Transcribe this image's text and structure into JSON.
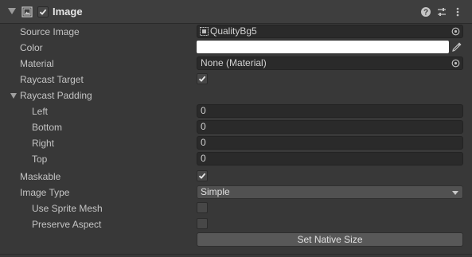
{
  "component": {
    "title": "Image",
    "enabled": true,
    "icon": "image-component-icon",
    "header_icons": [
      "help-icon",
      "preset-icon",
      "menu-kebab-icon"
    ]
  },
  "fields": {
    "source_image": {
      "label": "Source Image",
      "value": "QualityBg5",
      "icon": "sprite-icon"
    },
    "color": {
      "label": "Color",
      "value": "#ffffff"
    },
    "material": {
      "label": "Material",
      "value": "None (Material)"
    },
    "raycast_target": {
      "label": "Raycast Target",
      "checked": true
    },
    "raycast_padding": {
      "label": "Raycast Padding",
      "expanded": true,
      "left": {
        "label": "Left",
        "value": "0"
      },
      "bottom": {
        "label": "Bottom",
        "value": "0"
      },
      "right": {
        "label": "Right",
        "value": "0"
      },
      "top": {
        "label": "Top",
        "value": "0"
      }
    },
    "maskable": {
      "label": "Maskable",
      "checked": true
    },
    "image_type": {
      "label": "Image Type",
      "value": "Simple"
    },
    "use_sprite_mesh": {
      "label": "Use Sprite Mesh",
      "checked": false
    },
    "preserve_aspect": {
      "label": "Preserve Aspect",
      "checked": false
    }
  },
  "actions": {
    "set_native_size": "Set Native Size"
  },
  "colors": {
    "background": "#383838",
    "header": "#3e3e3e",
    "field": "#2a2a2a",
    "text": "#c4c4c4"
  }
}
